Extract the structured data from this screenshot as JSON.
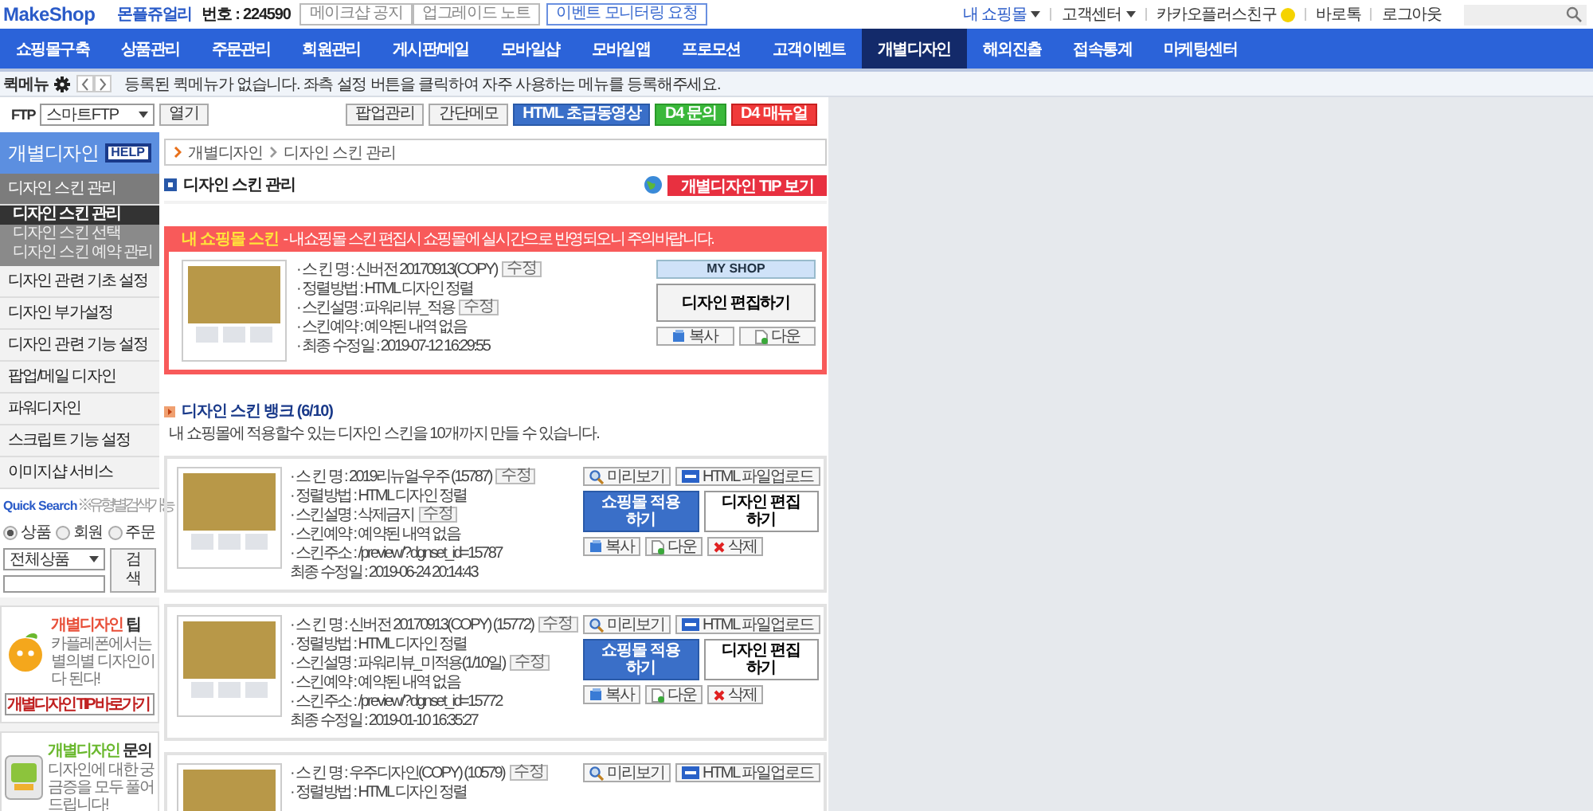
{
  "header": {
    "logo": "MakeShop",
    "shop_name": "몬플쥬얼리",
    "shop_no": "번호 : 224590",
    "top_buttons": [
      {
        "label": "메이크샵 공지",
        "kind": "plain"
      },
      {
        "label": "업그레이드 노트",
        "kind": "plain"
      },
      {
        "label": "이벤트 모니터링 요청",
        "kind": "blue"
      }
    ],
    "links": [
      {
        "label": "내 쇼핑몰",
        "kind": "menu",
        "highlight": true
      },
      {
        "label": "고객센터",
        "kind": "menu",
        "highlight": false
      },
      {
        "label": "카카오플러스친구",
        "kind": "kakao",
        "highlight": false
      },
      {
        "label": "바로톡",
        "kind": "plain",
        "highlight": false
      },
      {
        "label": "로그아웃",
        "kind": "plain",
        "highlight": false
      }
    ]
  },
  "nav": [
    {
      "label": "쇼핑몰구축",
      "selected": false
    },
    {
      "label": "상품관리",
      "selected": false
    },
    {
      "label": "주문관리",
      "selected": false
    },
    {
      "label": "회원관리",
      "selected": false
    },
    {
      "label": "게시판/메일",
      "selected": false
    },
    {
      "label": "모바일샵",
      "selected": false
    },
    {
      "label": "모바일앱",
      "selected": false
    },
    {
      "label": "프로모션",
      "selected": false
    },
    {
      "label": "고객이벤트",
      "selected": false
    },
    {
      "label": "개별디자인",
      "selected": true
    },
    {
      "label": "해외진출",
      "selected": false
    },
    {
      "label": "접속통계",
      "selected": false
    },
    {
      "label": "마케팅센터",
      "selected": false
    }
  ],
  "quick_menu": {
    "label": "퀵메뉴",
    "message": "등록된 퀵메뉴가 없습니다. 좌측 설정 버튼을 클릭하여 자주 사용하는 메뉴를 등록해주세요."
  },
  "toolbar": {
    "ftp_label": "FTP",
    "ftp_select": "스마트FTP",
    "open_button": "열기",
    "buttons": [
      {
        "label": "팝업관리",
        "kind": "plain"
      },
      {
        "label": "간단메모",
        "kind": "plain"
      },
      {
        "label": "HTML 초급동영상",
        "kind": "blue"
      },
      {
        "label": "D4 문의",
        "kind": "green"
      },
      {
        "label": "D4 매뉴얼",
        "kind": "red"
      }
    ]
  },
  "sidebar": {
    "title": "개별디자인",
    "help": "HELP",
    "sections": [
      {
        "label": "디자인 스킨 관리",
        "expanded": true,
        "children": [
          {
            "label": "디자인 스킨 관리",
            "selected": true
          },
          {
            "label": "디자인 스킨 선택",
            "selected": false
          },
          {
            "label": "디자인 스킨 예약 관리",
            "selected": false
          }
        ]
      },
      {
        "label": "디자인 관련 기초 설정",
        "expanded": false
      },
      {
        "label": "디자인 부가설정",
        "expanded": false
      },
      {
        "label": "디자인 관련 기능 설정",
        "expanded": false
      },
      {
        "label": "팝업/메일 디자인",
        "expanded": false
      },
      {
        "label": "파워디자인",
        "expanded": false
      },
      {
        "label": "스크립트 기능 설정",
        "expanded": false
      },
      {
        "label": "이미지샵 서비스",
        "expanded": false
      }
    ],
    "quick_search": {
      "title": "Quick Search",
      "note": "※유형별 검색가능",
      "radios": [
        {
          "label": "상품",
          "selected": true
        },
        {
          "label": "회원",
          "selected": false
        },
        {
          "label": "주문",
          "selected": false
        }
      ],
      "select": "전체상품",
      "button": "검색"
    },
    "promos": [
      {
        "kind": "tip",
        "title_colored": "개별디자인",
        "title_rest": "팁",
        "text": "카플레폰에서는 별의별 디자인이 다 된다!",
        "button": "개별디자인 TIP 바로가기"
      },
      {
        "kind": "ask",
        "title_colored": "개별디자인",
        "title_rest": "문의",
        "text": "디자인에 대한 궁금증을 모두 풀어드립니다!"
      }
    ]
  },
  "main": {
    "breadcrumb": [
      "개별디자인",
      "디자인 스킨 관리"
    ],
    "title": "디자인 스킨 관리",
    "tip_button": "개별디자인 TIP 보기",
    "my_skin": {
      "label": "내 쇼핑몰 스킨",
      "notice": "- 내쇼핑몰 스킨 편집시 쇼핑몰에 실시간으로 반영되오니 주의바랍니다.",
      "fields": [
        {
          "text": "· 스 킨 명 : 신버전 20170913(COPY)",
          "edit": "수정"
        },
        {
          "text": "· 정렬방법 : HTML 디자인 정렬"
        },
        {
          "text": "· 스킨설명 : 파워리뷰_적용",
          "edit": "수정"
        },
        {
          "text": "· 스킨예약 : 예약된 내역 없음"
        },
        {
          "text": "· 최종 수정일 : 2019-07-12 16:29:55"
        }
      ],
      "my_shop": "MY SHOP",
      "edit_button": "디자인 편집하기",
      "copy": "복사",
      "down": "다운"
    },
    "bank": {
      "title": "디자인 스킨 뱅크 (6/10)",
      "desc": "내 쇼핑몰에 적용할수 있는 디자인 스킨을 10개까지 만들 수 있습니다.",
      "items": [
        {
          "fields": [
            {
              "text": "· 스 킨 명 : 2019리뉴얼-우주 (15787)",
              "edit": "수정"
            },
            {
              "text": "· 정렬방법 : HTML 디자인 정렬"
            },
            {
              "text": "· 스킨설명 : 삭제금지",
              "edit": "수정"
            },
            {
              "text": "· 스킨예약 : 예약된 내역 없음"
            },
            {
              "text": "· 스킨주소 : /preview/?dgnset_id=15787"
            },
            {
              "text": "최종 수정일 : 2019-06-24 20:14:43"
            }
          ],
          "preview": "미리보기",
          "upload": "HTML 파일업로드",
          "apply": "쇼핑몰 적용하기",
          "edit": "디자인 편집하기",
          "copy": "복사",
          "down": "다운",
          "delete": "삭제"
        },
        {
          "fields": [
            {
              "text": "· 스 킨 명 : 신버전 20170913(COPY) (15772)",
              "edit": "수정"
            },
            {
              "text": "· 정렬방법 : HTML 디자인 정렬"
            },
            {
              "text": "· 스킨설명 : 파워리뷰_미적용(1/10일)",
              "edit": "수정"
            },
            {
              "text": "· 스킨예약 : 예약된 내역 없음"
            },
            {
              "text": "· 스킨주소 : /preview/?dgnset_id=15772"
            },
            {
              "text": "최종 수정일 : 2019-01-10 16:35:27"
            }
          ],
          "preview": "미리보기",
          "upload": "HTML 파일업로드",
          "apply": "쇼핑몰 적용하기",
          "edit": "디자인 편집하기",
          "copy": "복사",
          "down": "다운",
          "delete": "삭제"
        },
        {
          "fields": [
            {
              "text": "· 스 킨 명 : 우주디자인(COPY) (10579)",
              "edit": "수정"
            },
            {
              "text": "· 정렬방법 : HTML 디자인 정렬"
            }
          ],
          "preview": "미리보기",
          "upload": "HTML 파일업로드"
        }
      ]
    }
  }
}
